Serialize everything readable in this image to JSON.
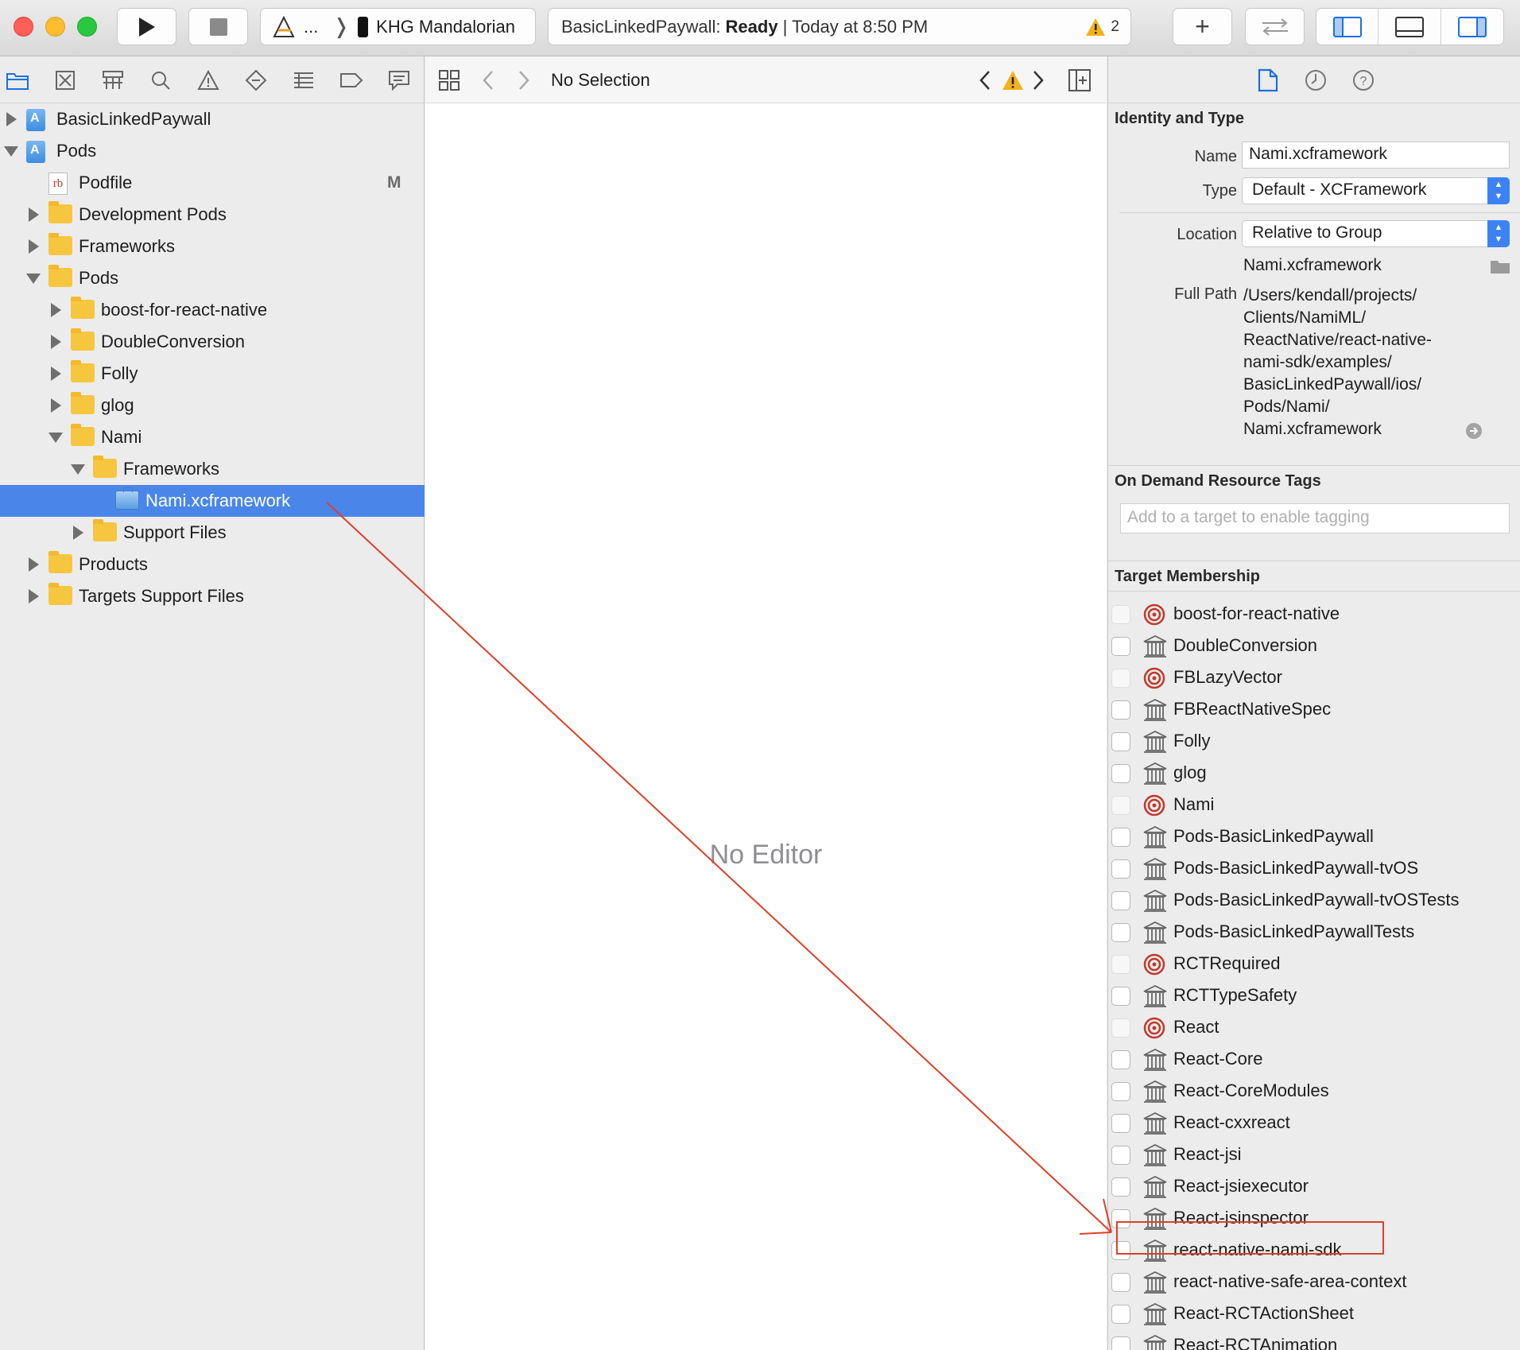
{
  "toolbar": {
    "scheme_prefix": "...",
    "device": "KHG Mandalorian",
    "activity_project": "BasicLinkedPaywall:",
    "activity_status": "Ready",
    "activity_time": "| Today at 8:50 PM",
    "warning_count": "2",
    "add_label": "+"
  },
  "navigator": {
    "tabs": [
      "project-navigator",
      "source-control",
      "symbol",
      "find",
      "issue",
      "test",
      "debug",
      "breakpoint",
      "report"
    ],
    "items": [
      {
        "label": "BasicLinkedPaywall",
        "icon": "project-icon",
        "disclosure": "collapsed"
      },
      {
        "label": "Pods",
        "icon": "project-icon",
        "disclosure": "expanded"
      },
      {
        "label": "Podfile",
        "icon": "ruby-file-icon",
        "disclosure": "none",
        "badge": "M"
      },
      {
        "label": "Development Pods",
        "icon": "folder-icon",
        "disclosure": "collapsed"
      },
      {
        "label": "Frameworks",
        "icon": "folder-icon",
        "disclosure": "collapsed"
      },
      {
        "label": "Pods",
        "icon": "folder-icon",
        "disclosure": "expanded"
      },
      {
        "label": "boost-for-react-native",
        "icon": "folder-icon",
        "disclosure": "collapsed"
      },
      {
        "label": "DoubleConversion",
        "icon": "folder-icon",
        "disclosure": "collapsed"
      },
      {
        "label": "Folly",
        "icon": "folder-icon",
        "disclosure": "collapsed"
      },
      {
        "label": "glog",
        "icon": "folder-icon",
        "disclosure": "collapsed"
      },
      {
        "label": "Nami",
        "icon": "folder-icon",
        "disclosure": "expanded"
      },
      {
        "label": "Frameworks",
        "icon": "folder-icon",
        "disclosure": "expanded"
      },
      {
        "label": "Nami.xcframework",
        "icon": "xcframework-icon",
        "disclosure": "none",
        "selected": true
      },
      {
        "label": "Support Files",
        "icon": "folder-icon",
        "disclosure": "collapsed"
      },
      {
        "label": "Products",
        "icon": "folder-icon",
        "disclosure": "collapsed"
      },
      {
        "label": "Targets Support Files",
        "icon": "folder-icon",
        "disclosure": "collapsed"
      }
    ]
  },
  "editor": {
    "jump_label": "No Selection",
    "empty_label": "No Editor"
  },
  "inspector": {
    "identity": {
      "title": "Identity and Type",
      "name_label": "Name",
      "name_value": "Nami.xcframework",
      "type_label": "Type",
      "type_value": "Default - XCFramework",
      "location_label": "Location",
      "location_value": "Relative to Group",
      "file_name": "Nami.xcframework",
      "full_path_label": "Full Path",
      "full_path_lines": [
        "/Users/kendall/projects/",
        "Clients/NamiML/",
        "ReactNative/react-native-",
        "nami-sdk/examples/",
        "BasicLinkedPaywall/ios/",
        "Pods/Nami/",
        "Nami.xcframework"
      ]
    },
    "odr": {
      "title": "On Demand Resource Tags",
      "placeholder": "Add to a target to enable tagging"
    },
    "targets": {
      "title": "Target Membership",
      "items": [
        {
          "label": "boost-for-react-native",
          "icon": "target-icon"
        },
        {
          "label": "DoubleConversion",
          "icon": "library-icon"
        },
        {
          "label": "FBLazyVector",
          "icon": "target-icon"
        },
        {
          "label": "FBReactNativeSpec",
          "icon": "library-icon"
        },
        {
          "label": "Folly",
          "icon": "library-icon"
        },
        {
          "label": "glog",
          "icon": "library-icon"
        },
        {
          "label": "Nami",
          "icon": "target-icon"
        },
        {
          "label": "Pods-BasicLinkedPaywall",
          "icon": "library-icon"
        },
        {
          "label": "Pods-BasicLinkedPaywall-tvOS",
          "icon": "library-icon"
        },
        {
          "label": "Pods-BasicLinkedPaywall-tvOSTests",
          "icon": "library-icon"
        },
        {
          "label": "Pods-BasicLinkedPaywallTests",
          "icon": "library-icon"
        },
        {
          "label": "RCTRequired",
          "icon": "target-icon"
        },
        {
          "label": "RCTTypeSafety",
          "icon": "library-icon"
        },
        {
          "label": "React",
          "icon": "target-icon"
        },
        {
          "label": "React-Core",
          "icon": "library-icon"
        },
        {
          "label": "React-CoreModules",
          "icon": "library-icon"
        },
        {
          "label": "React-cxxreact",
          "icon": "library-icon"
        },
        {
          "label": "React-jsi",
          "icon": "library-icon"
        },
        {
          "label": "React-jsiexecutor",
          "icon": "library-icon"
        },
        {
          "label": "React-jsinspector",
          "icon": "library-icon"
        },
        {
          "label": "react-native-nami-sdk",
          "icon": "library-icon",
          "highlighted": true
        },
        {
          "label": "react-native-safe-area-context",
          "icon": "library-icon"
        },
        {
          "label": "React-RCTActionSheet",
          "icon": "library-icon"
        },
        {
          "label": "React-RCTAnimation",
          "icon": "library-icon"
        }
      ]
    }
  },
  "colors": {
    "selection": "#4a86ea",
    "accent": "#3b82f6",
    "annotation": "#d9412b",
    "target_icon": "#c0392b"
  }
}
